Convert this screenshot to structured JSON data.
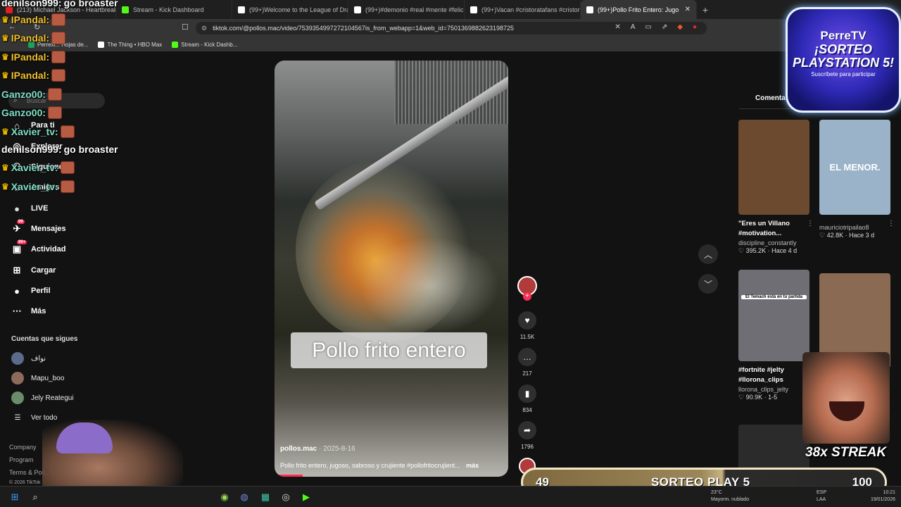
{
  "browser": {
    "tabs": [
      {
        "label": "(213) Michael Jackson - Heartbreak",
        "icon_color": "#e02020"
      },
      {
        "label": "Stream - Kick Dashboard",
        "icon_color": "#53fc18"
      },
      {
        "label": "(99+)Welcome to the League of Drav",
        "icon_color": "#ffffff"
      },
      {
        "label": "(99+)#demonio #real #mente #felici",
        "icon_color": "#ffffff"
      },
      {
        "label": "(99+)Vacan #cristoratafans #cristorat",
        "icon_color": "#ffffff"
      },
      {
        "label": "(99+)Pollo Frito Entero: Jugo",
        "icon_color": "#ffffff"
      }
    ],
    "new_tab": "+",
    "close_tab": "✕",
    "url": "tiktok.com/@pollos.mac/video/7539354997272104567is_from_webapp=1&web_id=7501369882623198725",
    "bookmarks": [
      {
        "label": "Perrexi... Hojas de...",
        "color": "#1aa260"
      },
      {
        "label": "The Thing • HBO Max",
        "color": "#ffffff"
      },
      {
        "label": "Stream - Kick Dashb...",
        "color": "#53fc18"
      }
    ]
  },
  "sidebar": {
    "search_placeholder": "Buscar",
    "items": [
      {
        "label": "Para ti",
        "icon": "home-icon",
        "glyph": "⌂"
      },
      {
        "label": "Explorar",
        "icon": "compass-icon",
        "glyph": "◎"
      },
      {
        "label": "Siguiendo",
        "icon": "following-icon",
        "glyph": "⚇"
      },
      {
        "label": "Amigos",
        "icon": "friends-icon",
        "glyph": "☺"
      },
      {
        "label": "LIVE",
        "icon": "live-icon",
        "glyph": "●"
      },
      {
        "label": "Mensajes",
        "icon": "messages-icon",
        "glyph": "✈",
        "badge": "99"
      },
      {
        "label": "Actividad",
        "icon": "activity-icon",
        "glyph": "▣",
        "badge": "99+"
      },
      {
        "label": "Cargar",
        "icon": "upload-icon",
        "glyph": "⊞"
      },
      {
        "label": "Perfil",
        "icon": "profile-icon",
        "glyph": "●"
      },
      {
        "label": "Más",
        "icon": "more-icon",
        "glyph": "⋯"
      }
    ],
    "following_title": "Cuentas que sigues",
    "following": [
      "نواف",
      "Mapu_boo",
      "Jely Reategui"
    ],
    "see_all": "Ver todo",
    "footer": [
      "Company",
      "Program",
      "Terms & Poli...",
      "© 2026 TikTok"
    ]
  },
  "chat": [
    {
      "user": "denilson999:",
      "msg": "go broaster",
      "color": "#ffffff",
      "emote": false
    },
    {
      "user": "IPandal:",
      "msg": "",
      "color": "#f0c030",
      "emote": true,
      "crown": true
    },
    {
      "user": "IPandal:",
      "msg": "",
      "color": "#f0c030",
      "emote": true,
      "crown": true
    },
    {
      "user": "IPandal:",
      "msg": "",
      "color": "#f0c030",
      "emote": true,
      "crown": true
    },
    {
      "user": "IPandal:",
      "msg": "",
      "color": "#f0c030",
      "emote": true,
      "crown": true
    },
    {
      "user": "Ganzo00:",
      "msg": "",
      "color": "#7fe0c8",
      "emote": true,
      "crown": false
    },
    {
      "user": "Ganzo00:",
      "msg": "",
      "color": "#7fe0c8",
      "emote": true,
      "crown": false
    },
    {
      "user": "Xavier_tv:",
      "msg": "",
      "color": "#7fe0c8",
      "emote": true,
      "crown": true
    },
    {
      "user": "denilson999:",
      "msg": "go broaster",
      "color": "#ffffff",
      "emote": false
    },
    {
      "user": "Xavier_tv:",
      "msg": "",
      "color": "#7fe0c8",
      "emote": true,
      "crown": true
    },
    {
      "user": "Xavier_tv:",
      "msg": "",
      "color": "#7fe0c8",
      "emote": true,
      "crown": true
    }
  ],
  "video": {
    "overlay_text": "Pollo frito entero",
    "author": "pollos.mac",
    "date": "2025-8-16",
    "description": "Pollo frito entero,  jugoso, sabroso y crujiente #pollofritocrujient...",
    "more": "más"
  },
  "actions": {
    "likes": "11.5K",
    "comments": "217",
    "saves": "834",
    "shares": "1796"
  },
  "right": {
    "tab": "Comentarios",
    "cards": [
      {
        "title": "\"Eres un Villano #motivation...",
        "user": "discipline_constantly",
        "stats": "♡ 395.2K · Hace 4 d",
        "thumb": "#6b4a30",
        "thumb_text": ""
      },
      {
        "title": "",
        "user": "mauriciotripailao8",
        "stats": "♡ 42.8K · Hace 3 d",
        "thumb": "#9ab3c9",
        "thumb_text": "EL MENOR."
      },
      {
        "title": "#fortnite #jelty #llorona_clips",
        "user": "llorona_clips_jelty",
        "stats": "♡ 90.9K · 1-5",
        "thumb": "#6e6e74",
        "thumb_text": "El Temach está en tu partida"
      },
      {
        "title": "",
        "user": "",
        "stats": "",
        "thumb": "#8a6a52",
        "thumb_text": ""
      },
      {
        "title": "",
        "user": "",
        "stats": "",
        "thumb": "#2b2b2b",
        "thumb_text": ""
      }
    ]
  },
  "stream_overlay": {
    "logo_name": "PerreTV",
    "logo_line": "¡SORTEO PLAYSTATION 5!",
    "logo_sub": "Suscríbete para participar",
    "streak": "38x STREAK",
    "progress_current": "49",
    "progress_label": "SORTEO PLAY 5",
    "progress_goal": "100",
    "progress_fraction": 0.49
  },
  "taskbar": {
    "weather": "23°C",
    "weather_sub": "Mayorm. nublado",
    "lang": "ESP",
    "lang_sub": "LAA",
    "time": "10:21",
    "date": "19/01/2026"
  }
}
